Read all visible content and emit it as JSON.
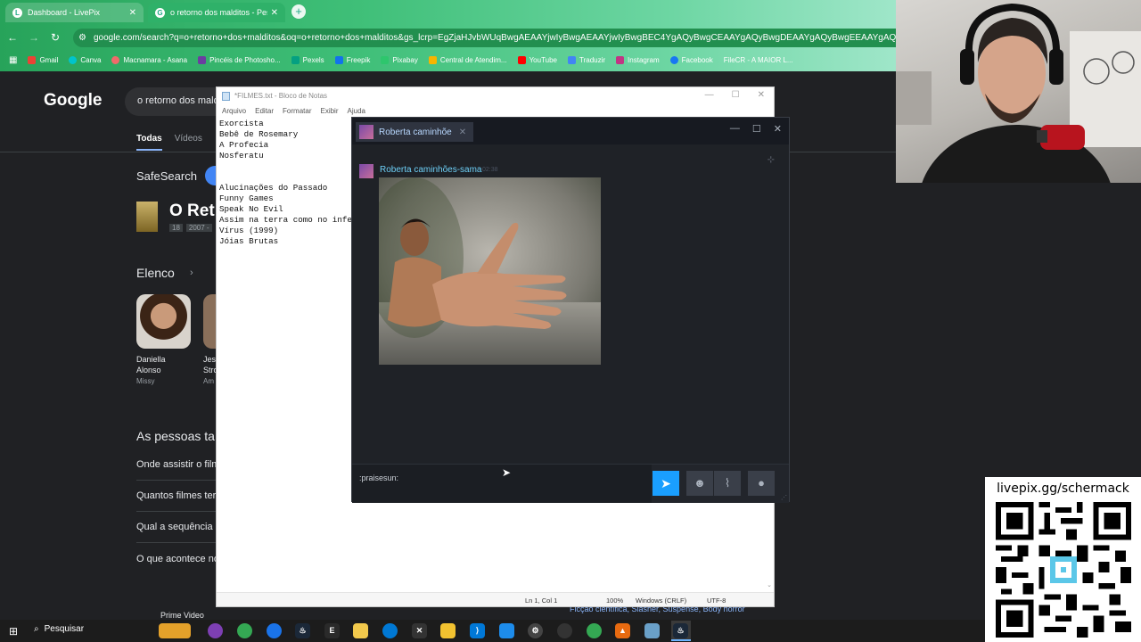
{
  "browser": {
    "tabs": [
      {
        "title": "Dashboard - LivePix",
        "active": false
      },
      {
        "title": "o retorno dos malditos - Pesqu",
        "active": true
      }
    ],
    "url": "google.com/search?q=o+retorno+dos+malditos&oq=o+retorno+dos+malditos&gs_lcrp=EgZjaHJvbWUqBwgAEAAYjwIyBwgAEAAYjwIyBwgBEC4YgAQyBwgCEAAYgAQyBwgDEAAYgAQyBwgEEAAYgAQyBwgFEAAYgAQyBwgFEAAYgAQyBw",
    "bookmarks": [
      {
        "label": "Gmail",
        "color": "#ea4335"
      },
      {
        "label": "Canva",
        "color": "#00c4cc"
      },
      {
        "label": "Macnamara - Asana",
        "color": "#f06a6a"
      },
      {
        "label": "Pincéis de Photosho...",
        "color": "#6b3fa0"
      },
      {
        "label": "Pexels",
        "color": "#05a081"
      },
      {
        "label": "Freepik",
        "color": "#1273eb"
      },
      {
        "label": "Pixabay",
        "color": "#2ec66d"
      },
      {
        "label": "Central de Atendim...",
        "color": "#f7b500"
      },
      {
        "label": "YouTube",
        "color": "#ff0000"
      },
      {
        "label": "Traduzir",
        "color": "#4285f4"
      },
      {
        "label": "Instagram",
        "color": "#c13584"
      },
      {
        "label": "Facebook",
        "color": "#1877f2"
      },
      {
        "label": "FileCR - A MAIOR L...",
        "color": "#2f8d4c"
      }
    ]
  },
  "google": {
    "logo": "Google",
    "query": "o retorno dos maldi",
    "tabs": [
      "Todas",
      "Vídeos"
    ],
    "safesearch": "SafeSearch",
    "result_title": "O Ret",
    "result_rating": "18",
    "result_year": "2007 -",
    "elenco": "Elenco",
    "cast": [
      {
        "name": "Daniella Alonso",
        "role": "Missy"
      },
      {
        "name": "Jes Stro",
        "role": "Am"
      }
    ],
    "people_ask": "As pessoas ta",
    "questions": [
      "Onde assistir o film",
      "Quantos filmes ter",
      "Qual a sequência c",
      "O que acontece no"
    ],
    "prime": "Prime Video",
    "genres": "Ficção científica, Slasher, Suspense, Body horror"
  },
  "notepad": {
    "title": "*FILMES.txt - Bloco de Notas",
    "menu": [
      "Arquivo",
      "Editar",
      "Formatar",
      "Exibir",
      "Ajuda"
    ],
    "content": "Exorcista\nBebê de Rosemary\nA Profecia\nNosferatu\n\n\nAlucinações do Passado\nFunny Games\nSpeak No Evil\nAssim na terra como no infer\nVírus (1999)\nJóias Brutas",
    "status": {
      "position": "Ln 1, Col 1",
      "zoom": "100%",
      "eol": "Windows (CRLF)",
      "encoding": "UTF-8"
    }
  },
  "steam": {
    "tab_name": "Roberta caminhõe",
    "sender": "Roberta caminhões-sama",
    "time": "02:38",
    "input_value": ":praisesun:"
  },
  "overlay": {
    "qr_url": "livepix.gg/schermack"
  },
  "taskbar": {
    "search_label": "Pesquisar"
  }
}
